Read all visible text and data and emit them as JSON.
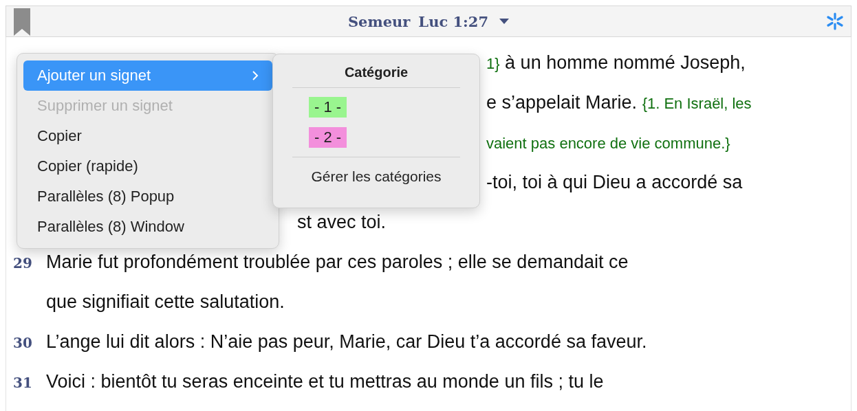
{
  "header": {
    "version": "Semeur",
    "reference": "Luc 1:27"
  },
  "lines": [
    {
      "segments": [
        {
          "kind": "note",
          "text": "1}"
        },
        {
          "kind": "text",
          "text": " à un homme nommé Joseph,"
        }
      ]
    },
    {
      "segments": [
        {
          "kind": "text",
          "text": "e s’appelait Marie. "
        },
        {
          "kind": "note",
          "text": "{1. En Israël, les"
        }
      ]
    },
    {
      "segments": [
        {
          "kind": "note",
          "text": "vaient pas encore de vie commune.}"
        }
      ]
    },
    {
      "segments": [
        {
          "kind": "text",
          "text": "-toi, toi à qui Dieu a accordé sa"
        }
      ]
    },
    {
      "segments": [
        {
          "kind": "text",
          "text": "st avec toi."
        }
      ]
    },
    {
      "number": "29",
      "segments": [
        {
          "kind": "text",
          "text": "Marie fut profondément troublée par ces paroles ; elle se demandait ce"
        }
      ]
    },
    {
      "segments": [
        {
          "kind": "text",
          "text": "que signifiait cette salutation."
        }
      ]
    },
    {
      "number": "30",
      "segments": [
        {
          "kind": "text",
          "text": "L’ange lui dit alors : N’aie pas peur, Marie, car Dieu t’a accordé sa faveur."
        }
      ]
    },
    {
      "number": "31",
      "segments": [
        {
          "kind": "text",
          "text": "Voici : bientôt tu seras enceinte et tu mettras au monde un fils ; tu le"
        }
      ]
    }
  ],
  "context_menu": {
    "items": [
      {
        "label": "Ajouter un signet",
        "selected": true,
        "disabled": false,
        "has_submenu": true
      },
      {
        "label": "Supprimer un signet",
        "selected": false,
        "disabled": true,
        "has_submenu": false
      },
      {
        "label": "Copier",
        "selected": false,
        "disabled": false,
        "has_submenu": false
      },
      {
        "label": "Copier (rapide)",
        "selected": false,
        "disabled": false,
        "has_submenu": false
      },
      {
        "label": "Parallèles (8) Popup",
        "selected": false,
        "disabled": false,
        "has_submenu": false
      },
      {
        "label": "Parallèles (8) Window",
        "selected": false,
        "disabled": false,
        "has_submenu": false
      }
    ]
  },
  "submenu": {
    "title": "Catégorie",
    "categories": [
      {
        "label": "- 1 -",
        "color": "#99f58f"
      },
      {
        "label": "- 2 -",
        "color": "#f38fdc"
      }
    ],
    "manage": "Gérer les catégories"
  }
}
